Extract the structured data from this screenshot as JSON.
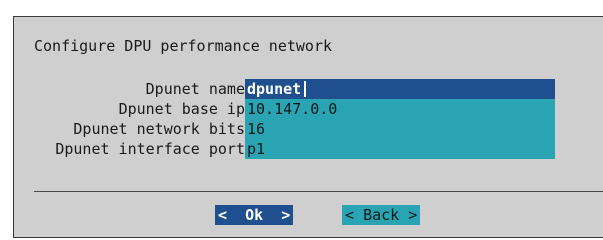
{
  "dialog": {
    "title": "Configure DPU performance network",
    "fields": [
      {
        "label": "Dpunet name",
        "value": "dpunet"
      },
      {
        "label": "Dpunet base ip",
        "value": "10.147.0.0"
      },
      {
        "label": "Dpunet network bits",
        "value": "16"
      },
      {
        "label": "Dpunet interface port",
        "value": "p1"
      }
    ],
    "ok_button": {
      "left_marker": "<",
      "label": "Ok",
      "right_marker": ">"
    },
    "back_button": {
      "left_marker": "<",
      "label": "Back",
      "right_marker": ">"
    }
  },
  "colors": {
    "dialog_bg": "#cfcfcf",
    "field_bg": "#2aa3b3",
    "focus_bg": "#1f4f8f"
  }
}
